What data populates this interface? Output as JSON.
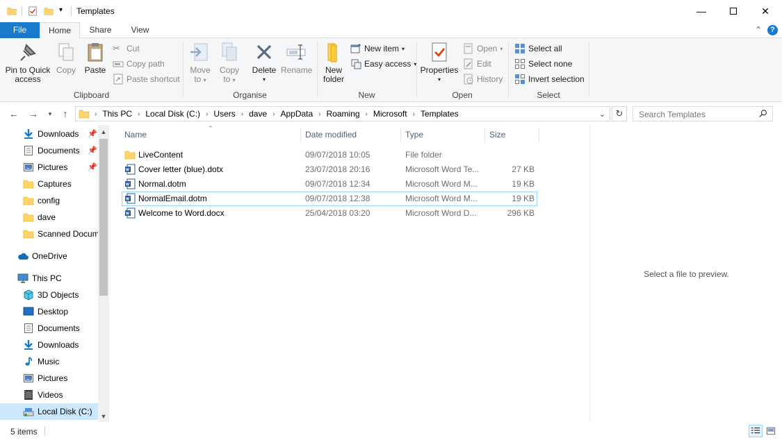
{
  "window": {
    "title": "Templates",
    "colors": {
      "accent": "#1979ca",
      "selection": "#cce8ff",
      "folder": "#ffd66e",
      "word": "#2b579a"
    }
  },
  "tabs": [
    {
      "label": "File"
    },
    {
      "label": "Home"
    },
    {
      "label": "Share"
    },
    {
      "label": "View"
    }
  ],
  "ribbon": {
    "clipboard": {
      "pin": "Pin to Quick access",
      "pin_line1": "Pin to Quick",
      "pin_line2": "access",
      "copy": "Copy",
      "paste": "Paste",
      "cut": "Cut",
      "copy_path": "Copy path",
      "paste_shortcut": "Paste shortcut",
      "label": "Clipboard"
    },
    "organise": {
      "move_to_1": "Move",
      "move_to_2": "to",
      "copy_to_1": "Copy",
      "copy_to_2": "to",
      "delete": "Delete",
      "rename": "Rename",
      "label": "Organise"
    },
    "new": {
      "new_folder_1": "New",
      "new_folder_2": "folder",
      "new_item": "New item",
      "easy_access": "Easy access",
      "label": "New"
    },
    "open": {
      "properties": "Properties",
      "open": "Open",
      "edit": "Edit",
      "history": "History",
      "label": "Open"
    },
    "select": {
      "select_all": "Select all",
      "select_none": "Select none",
      "invert": "Invert selection",
      "label": "Select"
    },
    "help": "?"
  },
  "address": {
    "crumbs": [
      "This PC",
      "Local Disk (C:)",
      "Users",
      "dave",
      "AppData",
      "Roaming",
      "Microsoft",
      "Templates"
    ],
    "search_placeholder": "Search Templates"
  },
  "nav": {
    "items": [
      {
        "label": "Downloads",
        "icon": "download-icon",
        "pinned": true
      },
      {
        "label": "Documents",
        "icon": "document-icon",
        "pinned": true
      },
      {
        "label": "Pictures",
        "icon": "pictures-icon",
        "pinned": true
      },
      {
        "label": "Captures",
        "icon": "folder-icon",
        "pinned": false
      },
      {
        "label": "config",
        "icon": "folder-icon",
        "pinned": false
      },
      {
        "label": "dave",
        "icon": "folder-icon",
        "pinned": false
      },
      {
        "label": "Scanned Docum",
        "icon": "folder-icon",
        "pinned": false
      },
      {
        "label": "OneDrive",
        "icon": "cloud-icon",
        "pinned": false
      },
      {
        "label": "This PC",
        "icon": "computer-icon",
        "pinned": false
      },
      {
        "label": "3D Objects",
        "icon": "cube-icon",
        "pinned": false
      },
      {
        "label": "Desktop",
        "icon": "desktop-icon",
        "pinned": false
      },
      {
        "label": "Documents",
        "icon": "document-icon",
        "pinned": false
      },
      {
        "label": "Downloads",
        "icon": "download-icon",
        "pinned": false
      },
      {
        "label": "Music",
        "icon": "music-icon",
        "pinned": false
      },
      {
        "label": "Pictures",
        "icon": "pictures-icon",
        "pinned": false
      },
      {
        "label": "Videos",
        "icon": "video-icon",
        "pinned": false
      },
      {
        "label": "Local Disk (C:)",
        "icon": "drive-icon",
        "pinned": false
      }
    ]
  },
  "files": {
    "columns": {
      "name": "Name",
      "date": "Date modified",
      "type": "Type",
      "size": "Size"
    },
    "rows": [
      {
        "name": "LiveContent",
        "date": "09/07/2018 10:05",
        "type": "File folder",
        "size": "",
        "icon": "folder-icon"
      },
      {
        "name": "Cover letter (blue).dotx",
        "date": "23/07/2018 20:16",
        "type": "Microsoft Word Te...",
        "size": "27 KB",
        "icon": "word-icon"
      },
      {
        "name": "Normal.dotm",
        "date": "09/07/2018 12:34",
        "type": "Microsoft Word M...",
        "size": "19 KB",
        "icon": "word-icon"
      },
      {
        "name": "NormalEmail.dotm",
        "date": "09/07/2018 12:38",
        "type": "Microsoft Word M...",
        "size": "19 KB",
        "icon": "word-icon"
      },
      {
        "name": "Welcome to Word.docx",
        "date": "25/04/2018 03:20",
        "type": "Microsoft Word D...",
        "size": "296 KB",
        "icon": "word-icon"
      }
    ]
  },
  "preview": {
    "text": "Select a file to preview."
  },
  "status": {
    "items": "5 items"
  }
}
